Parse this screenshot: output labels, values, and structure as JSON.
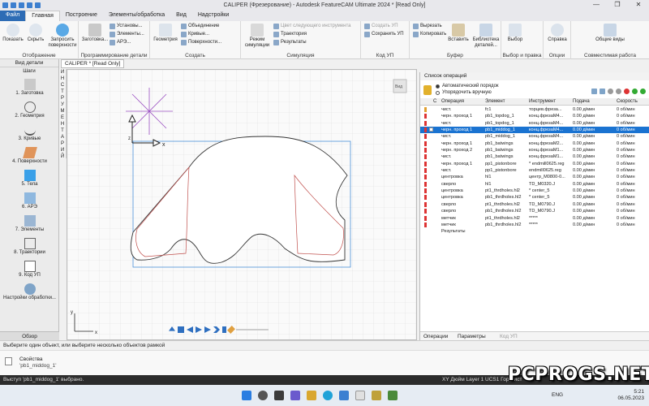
{
  "window": {
    "title": "CALIPER (Фрезерование) - Autodesk FeatureCAM Ultimate 2024 * [Read Only]",
    "controls": [
      "—",
      "❐",
      "✕"
    ]
  },
  "ribbon_tabs": [
    "Файл",
    "Главная",
    "Построение",
    "Элементы/обработка",
    "Вид",
    "Надстройки"
  ],
  "ribbon": {
    "groups": {
      "display": "Отображение",
      "program": "Программирование детали",
      "create": "Создать",
      "sim": "Симуляция",
      "nc": "Код УП",
      "buffer": "Буфер",
      "select": "Выбор и правка",
      "options": "Опции",
      "compat": "Совместимая работа"
    },
    "buttons": {
      "show": "Показать",
      "hide": "Скрыть",
      "hide_surfaces": "Запросить поверхности",
      "stock": "Заготовка...",
      "setups": "Установы...",
      "elements": "Элементы...",
      "are": "АРЭ...",
      "geometry": "Геометрия",
      "union": "Объединение",
      "curves": "Кривые...",
      "surfaces": "Поверхности...",
      "sim_mode": "Режим симуляции",
      "next_tool_color": "Цвет следующего инструмента",
      "toolpath": "Траектория",
      "results": "Результаты",
      "save_nc": "Сохранить УП",
      "create_nc": "Создать УП",
      "cut": "Вырезать",
      "copy": "Копировать",
      "paste": "Вставить",
      "library": "Библиотека деталей...",
      "select": "Выбор",
      "help": "Справка",
      "common_views": "Общие виды"
    }
  },
  "left_panel": {
    "header": "Вид детали",
    "steps_label": "Шаги",
    "steps": [
      "1. Заготовка",
      "2. Геометрия",
      "3. Кривые",
      "4. Поверхности",
      "5. Тела",
      "6. АРЭ",
      "7. Элементы",
      "8. Траектории",
      "9. Код УП",
      "Настройки обработки..."
    ],
    "overview": "Обзор"
  },
  "doc_tab": "CALIPER * [Read Only]",
  "vertical_toolbar": [
    "И",
    "Н",
    "С",
    "Т",
    "Р",
    "У",
    "М",
    "Е",
    "Н",
    "Т",
    "А",
    "Р",
    "И",
    "Й"
  ],
  "canvas": {
    "axis_x": "x",
    "axis_z": "z",
    "axis_y": "y",
    "view_button": "Вид"
  },
  "operations": {
    "title": "Список операций",
    "order_auto": "Автоматический порядок",
    "order_manual": "Упорядочить вручную",
    "columns": [
      "С",
      "Операция",
      "Элемент",
      "Инструмент",
      "Подача",
      "Скорость"
    ],
    "rows": [
      {
        "op": "чист.",
        "el": "fc1",
        "tool": "торцев.фреза...",
        "feed": "0.00 д/мин",
        "speed": "0 об/мин",
        "sel": false
      },
      {
        "op": "черн. проход 1",
        "el": "pb1_topdog_1",
        "tool": "конц.фрезаM4...",
        "feed": "0.00 д/мин",
        "speed": "0 об/мин",
        "sel": false
      },
      {
        "op": "чист.",
        "el": "pb1_topdog_1",
        "tool": "конц.фрезаM4...",
        "feed": "0.00 д/мин",
        "speed": "0 об/мин",
        "sel": false
      },
      {
        "op": "черн. проход 1",
        "el": "pb1_middog_1",
        "tool": "конц.фрезаM4...",
        "feed": "0.00 д/мин",
        "speed": "0 об/мин",
        "sel": true
      },
      {
        "op": "чист.",
        "el": "pb1_middog_1",
        "tool": "конц.фрезаM4...",
        "feed": "0.00 д/мин",
        "speed": "0 об/мин",
        "sel": false
      },
      {
        "op": "черн. проход 1",
        "el": "pb1_batwings",
        "tool": "конц.фрезаM2...",
        "feed": "0.00 д/мин",
        "speed": "0 об/мин",
        "sel": false
      },
      {
        "op": "черн. проход 2",
        "el": "pb1_batwings",
        "tool": "конц.фрезаM1...",
        "feed": "0.00 д/мин",
        "speed": "0 об/мин",
        "sel": false
      },
      {
        "op": "чист.",
        "el": "pb1_batwings",
        "tool": "конц.фрезаM1...",
        "feed": "0.00 д/мин",
        "speed": "0 об/мин",
        "sel": false
      },
      {
        "op": "черн. проход 1",
        "el": "pp1_pistonbore",
        "tool": "* endmill0625.reg",
        "feed": "0.00 д/мин",
        "speed": "0 об/мин",
        "sel": false
      },
      {
        "op": "чист.",
        "el": "pp1_pistonbore",
        "tool": "endmill0625.reg",
        "feed": "0.00 д/мин",
        "speed": "0 об/мин",
        "sel": false
      },
      {
        "op": "центровка",
        "el": "hl1",
        "tool": "центр_M0800-0...",
        "feed": "0.00 д/мин",
        "speed": "0 об/мин",
        "sel": false
      },
      {
        "op": "сверло",
        "el": "hl1",
        "tool": "TD_M0320.J",
        "feed": "0.00 д/мин",
        "speed": "0 об/мин",
        "sel": false
      },
      {
        "op": "центровка",
        "el": "pt1_thrdholes.hl2",
        "tool": "* center_5",
        "feed": "0.00 д/мин",
        "speed": "0 об/мин",
        "sel": false
      },
      {
        "op": "центровка",
        "el": "pb1_thrdholes.hl2",
        "tool": "* center_5",
        "feed": "0.00 д/мин",
        "speed": "0 об/мин",
        "sel": false
      },
      {
        "op": "сверло",
        "el": "pt1_thrdholes.hl2",
        "tool": "TD_M0790.J",
        "feed": "0.00 д/мин",
        "speed": "0 об/мин",
        "sel": false
      },
      {
        "op": "сверло",
        "el": "pb1_thrdholes.hl2",
        "tool": "TD_M0790.J",
        "feed": "0.00 д/мин",
        "speed": "0 об/мин",
        "sel": false
      },
      {
        "op": "метчик",
        "el": "pt1_thrdholes.hl2",
        "tool": "*****",
        "feed": "0.00 д/мин",
        "speed": "0 об/мин",
        "sel": false
      },
      {
        "op": "метчик",
        "el": "pb1_thrdholes.hl2",
        "tool": "*****",
        "feed": "0.00 д/мин",
        "speed": "0 об/мин",
        "sel": false
      },
      {
        "op": "Результаты",
        "el": "",
        "tool": "",
        "feed": "",
        "speed": "",
        "sel": false
      }
    ],
    "bottom_tabs": [
      "Операции",
      "Параметры",
      "Код УП"
    ]
  },
  "hint": "Выберите один объект, или выберите несколько объектов рамкой",
  "properties": {
    "title": "Свойства",
    "value": "'pb1_middog_1'"
  },
  "status": {
    "left": "Выступ 'pb1_middog_1' выбрано.",
    "right": "XY  Дюйм  Layer 1  UCS1  Гор  Лист"
  },
  "taskbar": {
    "lang": "ENG",
    "time": "5:21",
    "date": "06.05.2023"
  },
  "watermark": "PCPROGS.NET",
  "colors": {
    "accent": "#2d6cb5",
    "selection": "#1a73d1",
    "part_outline": "#c0504d",
    "stock_box": "#4a90d9",
    "setup_marker": "#9b4fc2"
  }
}
